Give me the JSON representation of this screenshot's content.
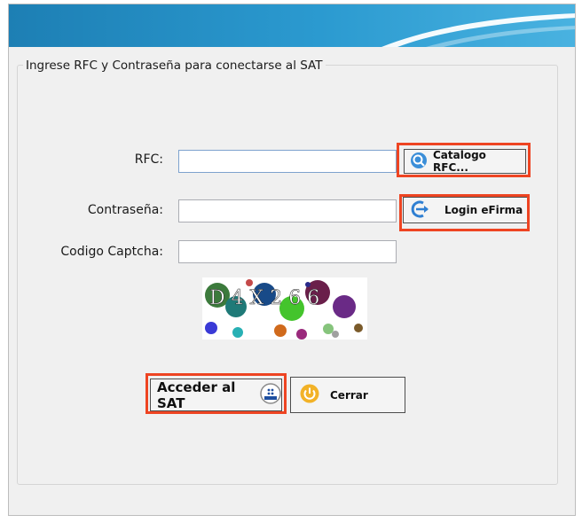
{
  "group_title": "Ingrese RFC y Contraseña para conectarse al SAT",
  "form": {
    "rfc_label": "RFC:",
    "rfc_value": "",
    "password_label": "Contraseña:",
    "password_value": "",
    "captcha_label": "Codigo Captcha:",
    "captcha_value": ""
  },
  "captcha_text": "D4X2 66",
  "buttons": {
    "catalogo": "Catalogo RFC...",
    "efirma": "Login eFirma",
    "acceder": "Acceder al SAT",
    "cerrar": "Cerrar"
  },
  "colors": {
    "banner": "#2b9ad0",
    "highlight": "#ee4422"
  },
  "icons": {
    "catalogo": "magnifier-icon",
    "efirma": "efirma-arrow-icon",
    "acceder": "sat-logo-icon",
    "cerrar": "power-icon"
  }
}
